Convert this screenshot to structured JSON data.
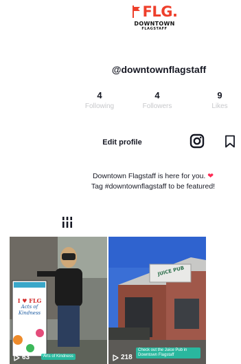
{
  "brand": {
    "logo_mark": "FLG.",
    "logo_sub": "DOWNTOWN",
    "logo_sub2": "FLAGSTAFF",
    "accent": "#ee3f2b"
  },
  "profile": {
    "username": "@downtownflagstaff",
    "bio_line1": "Downtown Flagstaff is here for you.",
    "bio_heart": "❤",
    "bio_line2": "Tag #downtownflagstaff to be featured!"
  },
  "stats": [
    {
      "value": "4",
      "label": "Following"
    },
    {
      "value": "4",
      "label": "Followers"
    },
    {
      "value": "9",
      "label": "Likes"
    }
  ],
  "actions": {
    "edit_profile": "Edit profile",
    "instagram_icon": "instagram-icon",
    "bookmark_icon": "bookmark-icon"
  },
  "tabs": {
    "videos_icon": "grid-icon"
  },
  "videos": [
    {
      "views": "63",
      "caption": "Arts of Kindness",
      "play_icon": "play-icon"
    },
    {
      "views": "218",
      "caption": "Check out the Juice Pub in Downtown Flagstaff",
      "play_icon": "play-icon"
    }
  ],
  "video_art": {
    "sign_heart": "I ♥ FLG",
    "sign_line2": "Acts of",
    "sign_line3": "Kindness",
    "storefront_sign": "JUICE PUB"
  },
  "colors": {
    "text": "#161823",
    "muted": "#c7c8cb",
    "heart": "#fe2c55",
    "caption_bg": "#20c8aa"
  }
}
